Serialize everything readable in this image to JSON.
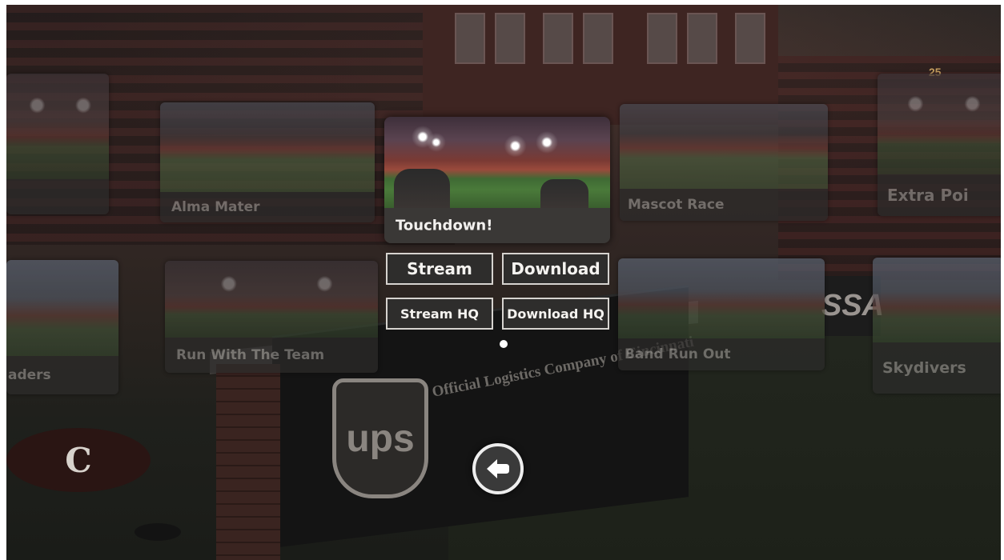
{
  "featured": {
    "title": "Touchdown!",
    "buttons": {
      "stream": "Stream",
      "download": "Download",
      "stream_hq": "Stream HQ",
      "download_hq": "Download HQ"
    }
  },
  "left_videos": [
    {
      "title": ""
    },
    {
      "title": "Alma Mater"
    },
    {
      "title": "aders"
    },
    {
      "title": "Run With The Team"
    }
  ],
  "right_videos": [
    {
      "title": "Mascot Race"
    },
    {
      "title": "Extra Poi"
    },
    {
      "title": "Band Run Out"
    },
    {
      "title": "Skydivers"
    }
  ],
  "pagination": {
    "total": 1,
    "current": 1
  },
  "back_icon": "back-arrow-icon",
  "scenery": {
    "ups_logo": "ups",
    "ups_slogan": "Official Logistics Company of Cincinnati",
    "team_logo": "C",
    "scoreboard": "25",
    "sign_text": "SSA"
  },
  "colors": {
    "button_border": "#d6d3cf",
    "caption_bg": "#2c2b2a",
    "featured_caption_text": "#f2f0ee"
  }
}
